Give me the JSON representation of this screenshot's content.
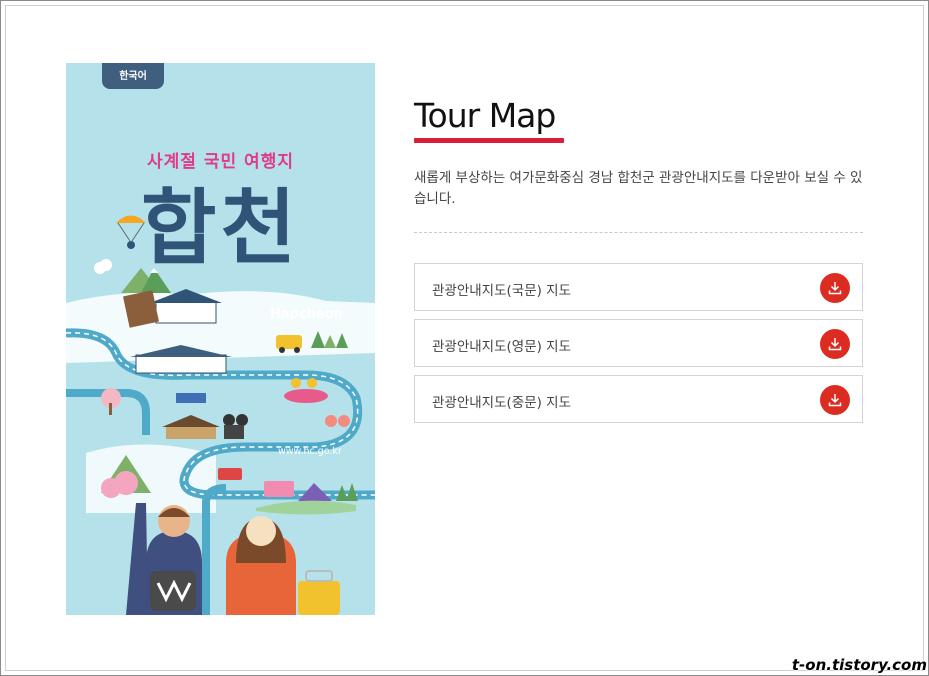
{
  "cover": {
    "language_tab": "한국어",
    "subtitle": "사계절 국민 여행지",
    "title": "합천",
    "brand": "Hapcheon",
    "url": "www.hc.go.kr"
  },
  "content": {
    "title": "Tour Map",
    "description": "새롭게 부상하는 여가문화중심 경남 합천군 관광안내지도를 다운받아 보실 수 있습니다.",
    "downloads": [
      {
        "label": "관광안내지도(국문) 지도",
        "icon": "download-icon"
      },
      {
        "label": "관광안내지도(영문) 지도",
        "icon": "download-icon"
      },
      {
        "label": "관광안내지도(중문) 지도",
        "icon": "download-icon"
      }
    ]
  },
  "watermark": "t-on.tistory.com",
  "colors": {
    "accent": "#d81e3a",
    "download_button": "#dc2c22",
    "cover_background": "#b5e2ea",
    "cover_title": "#2f5478",
    "cover_subtitle": "#e03b8b"
  }
}
